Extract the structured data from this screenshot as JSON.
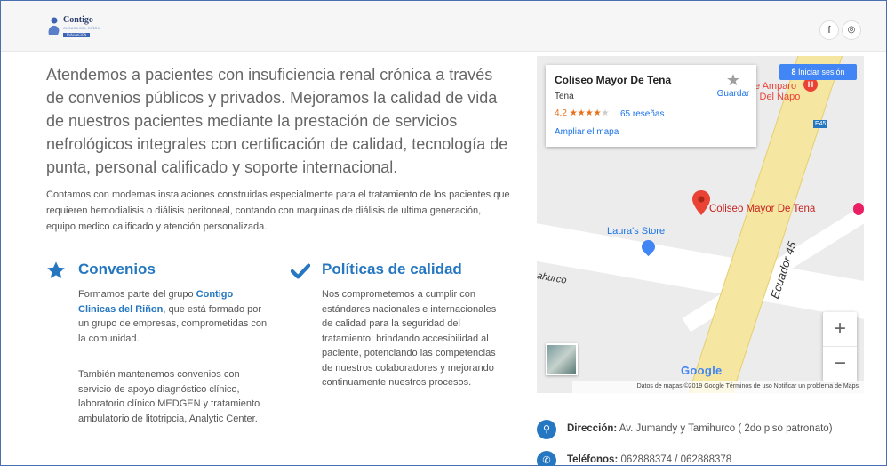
{
  "brand": {
    "name": "Contigo",
    "subtitle": "CLÍNICA DEL RIÑÓN",
    "badge": "EVALUACIÓN TENA"
  },
  "social": {
    "facebook": "f",
    "instagram": "◎"
  },
  "intro": "Atendemos a pacientes con insuficiencia renal crónica a través de convenios públicos y privados. Mejoramos la calidad de vida de nuestros pacientes mediante la prestación de servicios nefrológicos integrales con certificación de calidad, tecnología de punta, personal calificado y soporte internacional.",
  "description": "Contamos con modernas instalaciones construidas especialmente para el tratamiento de los pacientes que requieren hemodialisis o diálisis peritoneal, contando con maquinas de diálisis de ultima generación, equipo medico calificado y atención personalizada.",
  "features": {
    "convenios": {
      "title": "Convenios",
      "text_before": "Formamos parte del grupo ",
      "link": "Contigo Clinicas del Riñon",
      "text_after": ", que está formado por un grupo de empresas, comprometidas con la comunidad.",
      "text2": "También mantenemos convenios con servicio de apoyo diagnóstico clínico, laboratorio clínico MEDGEN y tratamiento ambulatorio de litotripcia, Analytic Center."
    },
    "calidad": {
      "title": "Políticas de calidad",
      "text": "Nos comprometemos a cumplir con estándares nacionales e internacionales de calidad para la seguridad del tratamiento; brindando accesibilidad al paciente, potenciando las competencias de nuestros colaboradores y mejorando continuamente nuestros procesos."
    }
  },
  "map": {
    "place": "Coliseo Mayor De Tena",
    "city": "Tena",
    "rating": "4,2",
    "stars": "★★★★",
    "star_empty": "★",
    "reviews": "65 reseñas",
    "expand": "Ampliar el mapa",
    "save": "Guardar",
    "signin": "Iniciar sesión",
    "pin_label": "Coliseo Mayor De Tena",
    "store": "Laura's Store",
    "road": "Ecuador 45",
    "street": "ahurco",
    "poi": "e Amparo\nl Del Napo",
    "shield": "E45",
    "google": "Google",
    "attribution": "Datos de mapas ©2019 Google   Términos de uso   Notificar un problema de Maps",
    "zoom_in": "+",
    "zoom_out": "−"
  },
  "contact": {
    "address_label": "Dirección:",
    "address": " Av. Jumandy y Tamihurco ( 2do piso patronato)",
    "phone_label": "Teléfonos:",
    "phone": " 062888374 / 062888378"
  },
  "colors": {
    "accent": "#2477c0",
    "map_road": "#f5e7a1",
    "pin": "#ea4335"
  }
}
